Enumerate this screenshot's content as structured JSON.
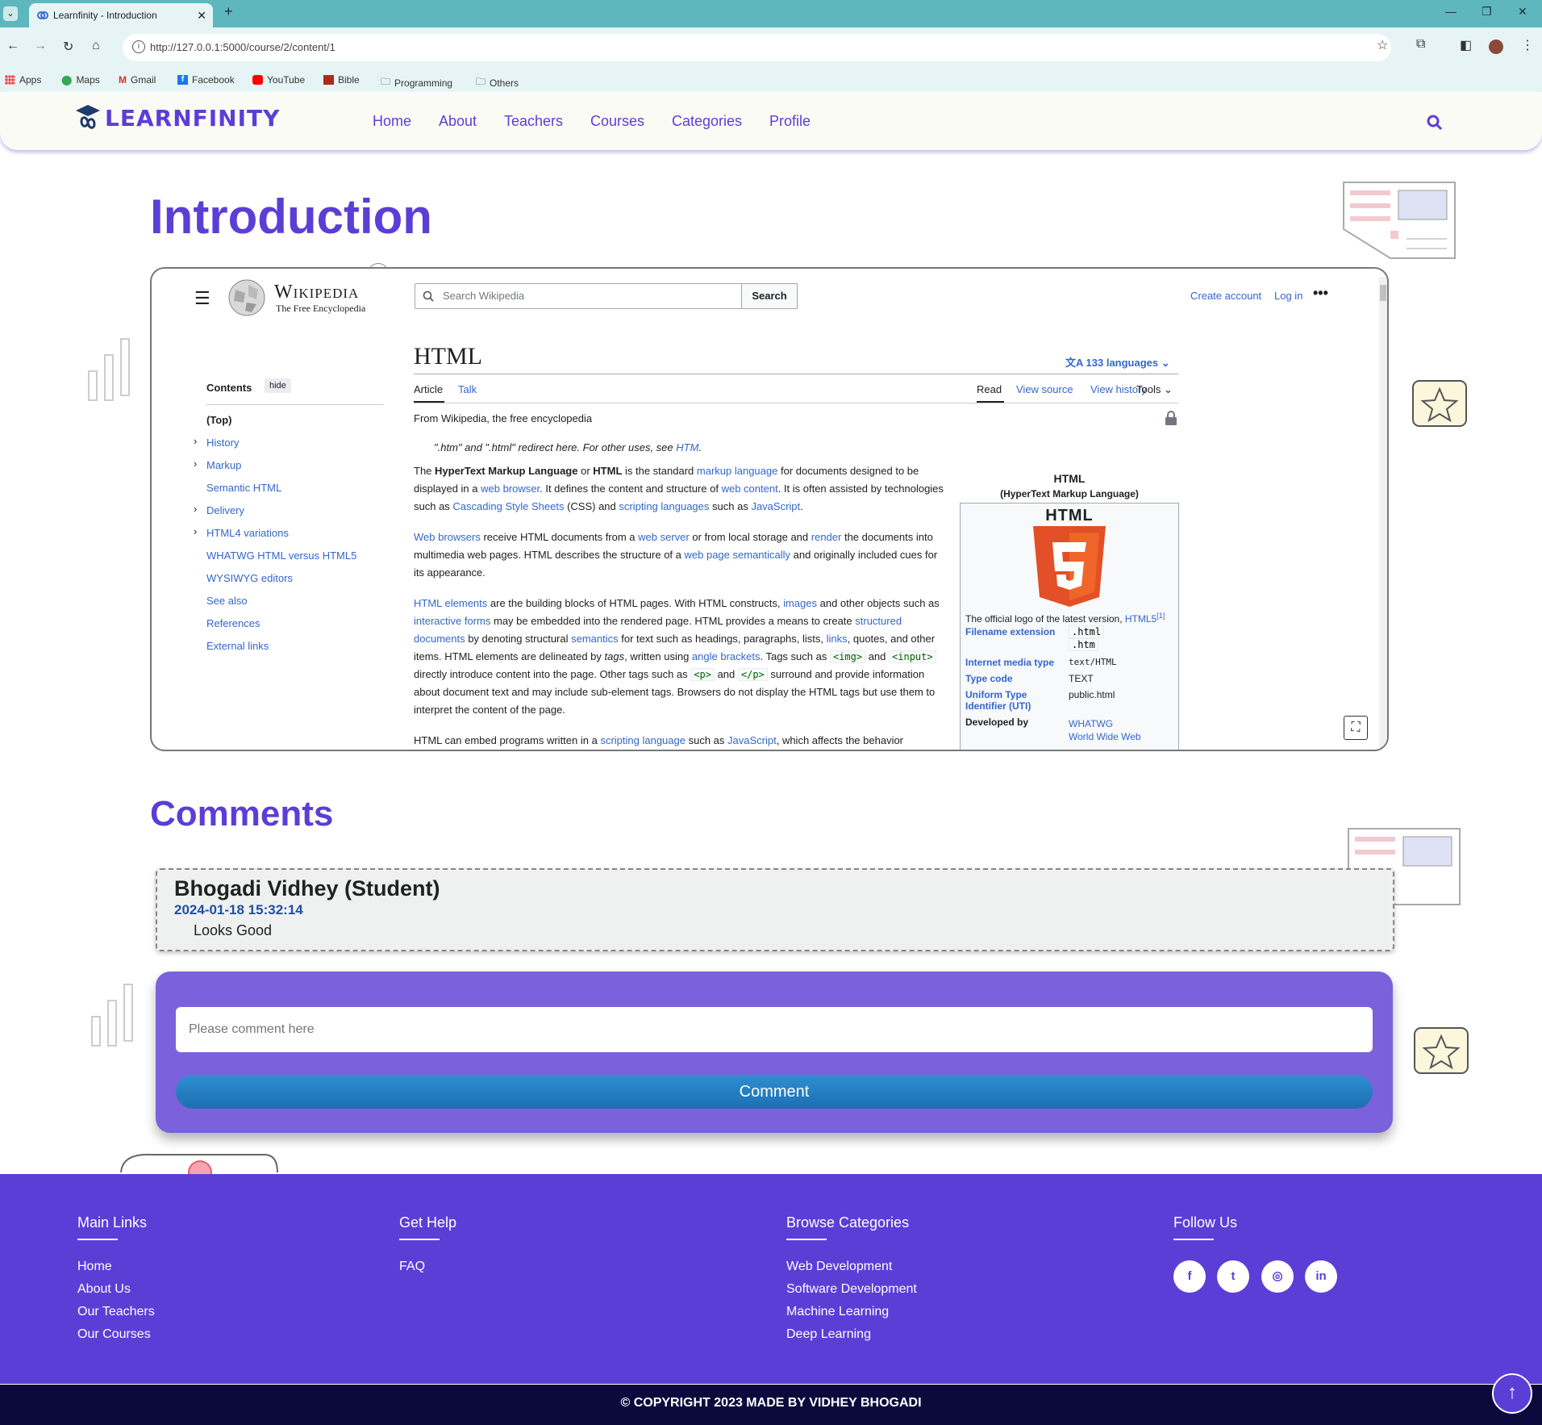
{
  "browser": {
    "tab_title": "Learnfinity - Introduction",
    "new_tab": "+",
    "url": "http://127.0.0.1:5000/course/2/content/1",
    "bookmarks": [
      "Apps",
      "Maps",
      "Gmail",
      "Facebook",
      "YouTube",
      "Bible",
      "Programming",
      "Others"
    ]
  },
  "site": {
    "brand": "LEARNFINITY",
    "nav": [
      "Home",
      "About",
      "Teachers",
      "Courses",
      "Categories",
      "Profile"
    ]
  },
  "content": {
    "title": "Introduction"
  },
  "wiki": {
    "brand": "Wikipedia",
    "tagline": "The Free Encyclopedia",
    "search_placeholder": "Search Wikipedia",
    "search_button": "Search",
    "create_account": "Create account",
    "log_in": "Log in",
    "contents_label": "Contents",
    "hide_label": "hide",
    "toc": [
      "(Top)",
      "History",
      "Markup",
      "Semantic HTML",
      "Delivery",
      "HTML4 variations",
      "WHATWG HTML versus HTML5",
      "WYSIWYG editors",
      "See also",
      "References",
      "External links"
    ],
    "article_title": "HTML",
    "languages": "133 languages",
    "tab_article": "Article",
    "tab_talk": "Talk",
    "tab_read": "Read",
    "tab_view_source": "View source",
    "tab_view_history": "View history",
    "tab_tools": "Tools",
    "from_line": "From Wikipedia, the free encyclopedia",
    "hatnote_a": "\".htm\" and \".html\" redirect here. For other uses, see ",
    "hatnote_link": "HTM",
    "hatnote_b": ".",
    "p1": {
      "a": "The ",
      "b": "HyperText Markup Language",
      "c": " or ",
      "d": "HTML",
      "e": " is the standard ",
      "f": "markup language",
      "g": " for documents designed to be displayed in a ",
      "h": "web browser",
      "i": ". It defines the content and structure of ",
      "j": "web content",
      "k": ". It is often assisted by technologies such as ",
      "l": "Cascading Style Sheets",
      "m": " (CSS) and ",
      "n": "scripting languages",
      "o": " such as ",
      "p": "JavaScript",
      "q": "."
    },
    "p2": {
      "a": "Web browsers",
      "b": " receive HTML documents from a ",
      "c": "web server",
      "d": " or from local storage and ",
      "e": "render",
      "f": " the documents into multimedia web pages. HTML describes the structure of a ",
      "g": "web page",
      "h": " ",
      "i": "semantically",
      "j": " and originally included cues for its appearance."
    },
    "p3": {
      "a": "HTML elements",
      "b": " are the building blocks of HTML pages. With HTML constructs, ",
      "c": "images",
      "d": " and other objects such as ",
      "e": "interactive forms",
      "f": " may be embedded into the rendered page. HTML provides a means to create ",
      "g": "structured documents",
      "h": " by denoting structural ",
      "i": "semantics",
      "j": " for text such as headings, paragraphs, lists, ",
      "k": "links",
      "l": ", quotes, and other items. HTML elements are delineated by ",
      "m": "tags",
      "n": ", written using ",
      "o": "angle brackets",
      "p": ". Tags such as ",
      "q": "<img>",
      "r": " and ",
      "s": "<input>",
      "t": " directly introduce content into the page. Other tags such as ",
      "u": "<p>",
      "v": " and ",
      "w": "</p>",
      "x": " surround and provide information about document text and may include sub-element tags. Browsers do not display the HTML tags but use them to interpret the content of the page."
    },
    "p4": {
      "a": "HTML can embed programs written in a ",
      "b": "scripting language",
      "c": " such as ",
      "d": "JavaScript",
      "e": ", which affects the behavior"
    },
    "infobox": {
      "title": "HTML",
      "subtitle": "(HyperText Markup Language)",
      "logo_text": "HTML",
      "caption_a": "The official logo of the latest version, ",
      "caption_link": "HTML5",
      "caption_ref": "[1]",
      "filename_label": "Filename extension",
      "filename_values": [
        ".html",
        ".htm"
      ],
      "media_label": "Internet media type",
      "media_value": "text/HTML",
      "type_label": "Type code",
      "type_value": "TEXT",
      "uti_label": "Uniform Type Identifier (UTI)",
      "uti_value": "public.html",
      "dev_label": "Developed by",
      "dev_values": [
        "WHATWG",
        "World Wide Web"
      ]
    }
  },
  "comments": {
    "title": "Comments",
    "items": [
      {
        "author": "Bhogadi Vidhey (Student)",
        "date": "2024-01-18 15:32:14",
        "text": "Looks Good"
      }
    ],
    "input_placeholder": "Please comment here",
    "submit_label": "Comment"
  },
  "footer": {
    "main_links": {
      "title": "Main Links",
      "items": [
        "Home",
        "About Us",
        "Our Teachers",
        "Our Courses"
      ]
    },
    "get_help": {
      "title": "Get Help",
      "items": [
        "FAQ"
      ]
    },
    "categories": {
      "title": "Browse Categories",
      "items": [
        "Web Development",
        "Software Development",
        "Machine Learning",
        "Deep Learning"
      ]
    },
    "follow": {
      "title": "Follow Us",
      "icons": [
        "facebook-icon",
        "twitter-icon",
        "instagram-icon",
        "linkedin-icon"
      ]
    },
    "copyright": "© COPYRIGHT 2023 MADE BY VIDHEY BHOGADI"
  },
  "colors": {
    "brand": "#5b3ed6",
    "footer_bottom": "#0c0a3d",
    "wiki_link": "#3366cc",
    "tab_bar": "#5fb7be"
  }
}
